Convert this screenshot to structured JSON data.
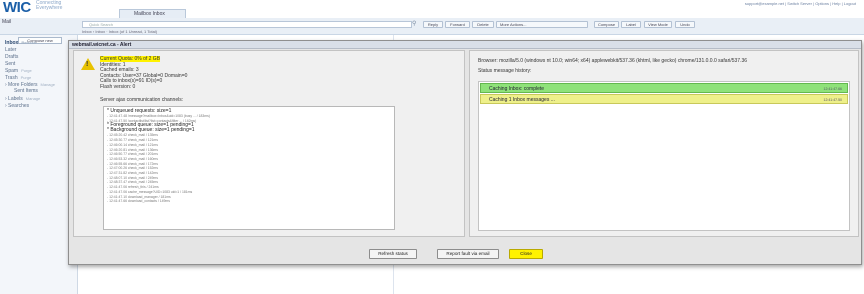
{
  "app": {
    "logo_text": "WIC",
    "logo_tagline_1": "Connecting",
    "logo_tagline_2": "Everywhere",
    "top_links": "support@example.net | Switch Server | Options | Help | Logout",
    "mailbox_tab": "Mailbox Inbox"
  },
  "header": {
    "left_label": "Mail",
    "search_placeholder": "Quick Search",
    "crumb": "Inbox › Inbox · Inbox (of 1 Unread, 1 Total)",
    "buttons": [
      "Reply",
      "Forward",
      "Delete",
      "More Actions...",
      "Compose",
      "Label",
      "View Mode",
      "Undo"
    ]
  },
  "sidebar": {
    "compose_label": "Compose new",
    "folders": [
      {
        "label": "Inbox",
        "count": "Refresh",
        "selected": true
      },
      {
        "label": "Later",
        "count": "",
        "selected": false
      },
      {
        "label": "Drafts",
        "count": "",
        "selected": false
      },
      {
        "label": "Sent",
        "count": "",
        "selected": false
      },
      {
        "label": "Spam",
        "count": "Purge",
        "selected": false
      },
      {
        "label": "Trash",
        "count": "Purge",
        "selected": false
      },
      {
        "label": "› More Folders",
        "count": "Manage",
        "selected": false
      },
      {
        "label": "Sent Items",
        "count": "",
        "selected": false
      },
      {
        "label": "› Labels",
        "count": "Manage",
        "selected": false
      },
      {
        "label": "› Searches",
        "count": "",
        "selected": false
      }
    ]
  },
  "dialog": {
    "title": "webmail.wicnet.ca - Alert",
    "quota_line": "Current Quota: 0% of 2 GB",
    "info_lines": [
      "Identities: 1",
      "Cached emails: 3",
      "Contacts: User=37 Global=0 Domain=0",
      "Calls to inbox(s)=91 ID(s)=0",
      "Flash version: 0"
    ],
    "server_ajax_label": "Server ajax communication channels:",
    "unqueued_label": "* Unqueued requests: size=1",
    "fg_label": "* Foreground queue: size=1 pending=1",
    "bg_label": "* Background queue: size=1 pending=1",
    "log_lines": [
      "- 12:41:47.48 /message?mailbox=Inbox&uid=1083 (busy ... / 183ms)",
      "- 12:41:47.50 /contactlist/list?list=contacts&filter ... / 162ms)",
      "- 12:45:20.42 check_mail / 135ms",
      "- 12:45:30.77 check_mail / 121ms",
      "- 12:46:00.14 check_mail / 121ms",
      "- 12:46:20.81 check_mail / 136ms",
      "- 12:46:50.77 check_mail / 201ms",
      "- 12:46:53.32 check_mail / 160ms",
      "- 12:46:55.66 check_mail / 172ms",
      "- 12:47:00.26 check_mail / 152ms",
      "- 12:47:31.82 check_mail / 142ms",
      "- 12:48:07.10 check_mail / 249ms",
      "- 12:48:37.47 check_mail / 245ms",
      "- 12:41:47.06 refresh_this / 241ms",
      "- 12:41:47.06 cache_message?UID=1083 uid=1 / 181ms",
      "- 12:41:47.10 download_manager / 181ms",
      "- 12:41:47.66 download_contacts / 149ms"
    ],
    "browser_line": "Browser: mozilla/5.0 (windows nt 10.0; win64; x64) applewebkit/537.36 (khtml, like gecko) chrome/131.0.0.0 safari/537.36",
    "history_label": "Status message history:",
    "history_rows": [
      {
        "text": "Caching Inbox: complete",
        "time": "12:41:47.66"
      },
      {
        "text": "Caching 1 Inbox messages ...",
        "time": "12:41:47.50"
      }
    ],
    "buttons": {
      "refresh": "Refresh status",
      "report": "Report fault via email",
      "close": "Close"
    }
  },
  "colors": {
    "highlight": "#fff200",
    "status_green": "#8fe27a",
    "status_yellow": "#eef08a",
    "brand": "#1b5fa8"
  }
}
